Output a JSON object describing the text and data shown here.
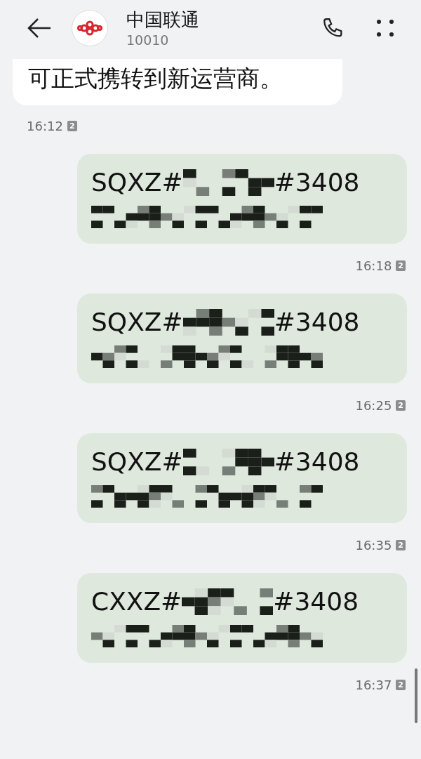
{
  "header": {
    "name": "中国联通",
    "number": "10010"
  },
  "incoming": {
    "text": "可正式携转到新运营商。",
    "time": "16:12",
    "sim": "2"
  },
  "sent": [
    {
      "prefix": "SQXZ#",
      "suffix": "#3408",
      "time": "16:18",
      "sim": "2"
    },
    {
      "prefix": "SQXZ#",
      "suffix": "#3408",
      "time": "16:25",
      "sim": "2"
    },
    {
      "prefix": "SQXZ#",
      "suffix": "#3408",
      "time": "16:35",
      "sim": "2"
    },
    {
      "prefix": "CXXZ#",
      "suffix": "#3408",
      "time": "16:37",
      "sim": "2"
    }
  ]
}
